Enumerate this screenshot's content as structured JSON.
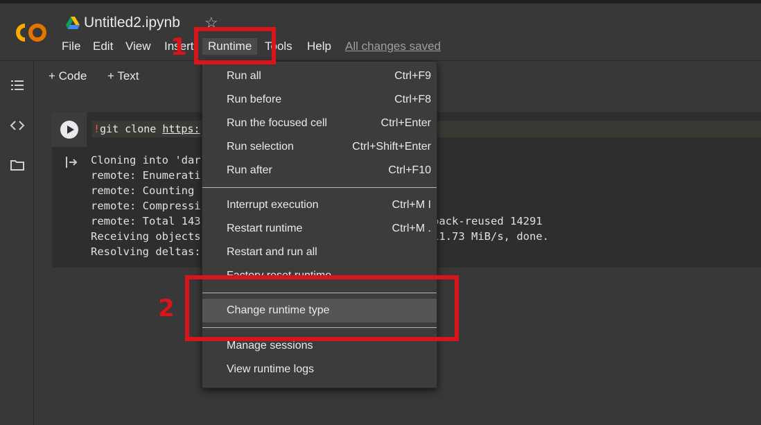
{
  "header": {
    "title": "Untitled2.ipynb",
    "logo_text": "CO",
    "menu": [
      "File",
      "Edit",
      "View",
      "Insert",
      "Runtime",
      "Tools",
      "Help"
    ],
    "saved_status": "All changes saved"
  },
  "toolbar": {
    "add_code": "+ Code",
    "add_text": "+ Text"
  },
  "cell": {
    "code_bang": "!",
    "code_cmd": "git clone ",
    "code_url": "https:",
    "output": [
      "Cloning into 'dar",
      "remote: Enumerati",
      "remote: Counting ",
      "remote: Compressi",
      "remote: Total 143",
      "Receiving objects",
      "Resolving deltas:"
    ],
    "output_tail": [
      "pack-reused 14291",
      "11.73 MiB/s, done."
    ]
  },
  "runtime_menu": {
    "items": [
      {
        "label": "Run all",
        "shortcut": "Ctrl+F9"
      },
      {
        "label": "Run before",
        "shortcut": "Ctrl+F8"
      },
      {
        "label": "Run the focused cell",
        "shortcut": "Ctrl+Enter"
      },
      {
        "label": "Run selection",
        "shortcut": "Ctrl+Shift+Enter"
      },
      {
        "label": "Run after",
        "shortcut": "Ctrl+F10"
      },
      {
        "label": "Interrupt execution",
        "shortcut": "Ctrl+M I"
      },
      {
        "label": "Restart runtime",
        "shortcut": "Ctrl+M ."
      },
      {
        "label": "Restart and run all",
        "shortcut": ""
      },
      {
        "label": "Factory reset runtime",
        "shortcut": ""
      },
      {
        "label": "Change runtime type",
        "shortcut": ""
      },
      {
        "label": "Manage sessions",
        "shortcut": ""
      },
      {
        "label": "View runtime logs",
        "shortcut": ""
      }
    ]
  },
  "annotations": {
    "step1": "1",
    "step2": "2",
    "color": "#d9141b"
  },
  "colors": {
    "background": "#383838",
    "menu_bg": "#3c3c3c",
    "highlight": "#555555",
    "logo_orange": "#f9ab00"
  }
}
